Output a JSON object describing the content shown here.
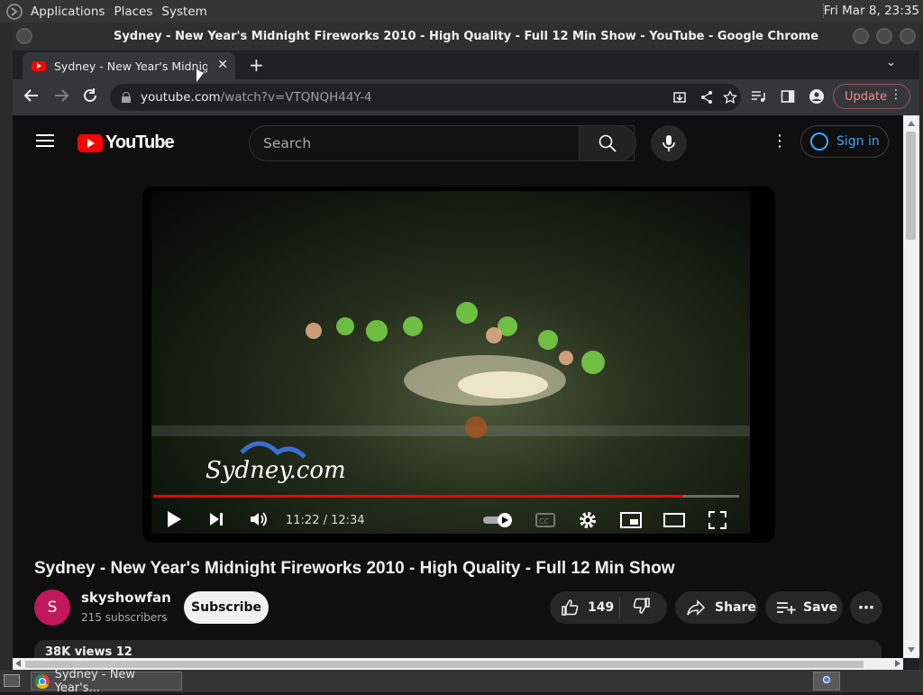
{
  "panel": {
    "menus": [
      "Applications",
      "Places",
      "System"
    ],
    "clock": "Fri Mar  8, 23:35"
  },
  "window": {
    "title": "Sydney - New Year's Midnight Fireworks 2010 - High Quality - Full 12 Min Show - YouTube - Google Chrome"
  },
  "browser": {
    "tab_title": "Sydney - New Year's Midnight",
    "url_host": "youtube.com",
    "url_path": "/watch?v=VTQNQH44Y-4",
    "update_label": "Update"
  },
  "youtube": {
    "logo_text": "YouTube",
    "search_placeholder": "Search",
    "signin_label": "Sign in",
    "player": {
      "current_time": "11:22",
      "duration": "12:34",
      "time_display": "11:22 / 12:34",
      "progress_fraction": 0.905,
      "watermark": "Sydney.com"
    },
    "video_title": "Sydney - New Year's Midnight Fireworks 2010 - High Quality - Full 12 Min Show",
    "channel": {
      "initial": "S",
      "name": "skyshowfan",
      "subscribers": "215 subscribers"
    },
    "subscribe_label": "Subscribe",
    "likes": "149",
    "share_label": "Share",
    "save_label": "Save",
    "description_preview": "38K views  12"
  },
  "taskbar": {
    "task_label": "Sydney - New Year's..."
  },
  "colors": {
    "yt_red": "#ff0000",
    "accent_blue": "#3ea6ff",
    "chan_avatar": "#c2185b"
  }
}
